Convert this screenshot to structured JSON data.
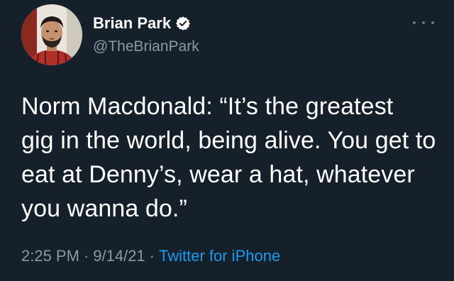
{
  "author": {
    "name": "Brian Park",
    "handle": "@TheBrianPark",
    "verified": true
  },
  "tweet": {
    "lines": [
      "Norm Macdonald: “It’s the greatest",
      "gig in the world, being alive. You get to",
      "eat at Denny’s, wear a hat, whatever",
      "you wanna do.”"
    ]
  },
  "meta": {
    "time": "2:25 PM",
    "date": "9/14/21",
    "separator": "·",
    "source": "Twitter for iPhone"
  },
  "colors": {
    "background": "#15202b",
    "text": "#ffffff",
    "secondary": "#8b98a5",
    "accent": "#1d9bf0"
  },
  "icons": {
    "verified": "verified-badge-icon",
    "more": "more-options-icon"
  }
}
